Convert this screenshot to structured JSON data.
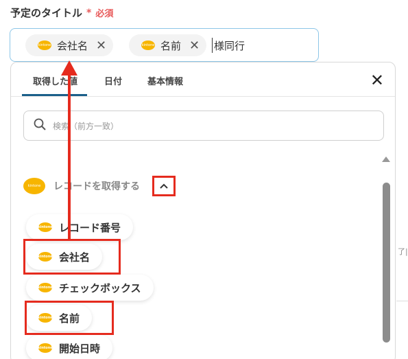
{
  "field": {
    "label": "予定のタイトル",
    "required_mark": "*",
    "required_text": "必須"
  },
  "title_input": {
    "chips": [
      {
        "label": "会社名"
      },
      {
        "label": "名前"
      }
    ],
    "trailing_text": "様同行"
  },
  "popup": {
    "tabs": [
      {
        "label": "取得した値"
      },
      {
        "label": "日付"
      },
      {
        "label": "基本情報"
      }
    ],
    "search_placeholder": "検索（前方一致）",
    "section_label": "レコードを取得する",
    "options": [
      {
        "label": "レコード番号"
      },
      {
        "label": "会社名"
      },
      {
        "label": "チェックボックス"
      },
      {
        "label": "名前"
      },
      {
        "label": "開始日時"
      }
    ]
  },
  "side_text": "了|",
  "colors": {
    "accent": "#1a5f8a",
    "highlight": "#e52b1e",
    "required": "#e85a5a",
    "kintone": "#f7b500",
    "input_border": "#8cc6e8"
  },
  "icons": {
    "close": "close-icon",
    "search": "search-icon",
    "chevron": "chevron-up-icon",
    "brand": "kintone-icon"
  }
}
